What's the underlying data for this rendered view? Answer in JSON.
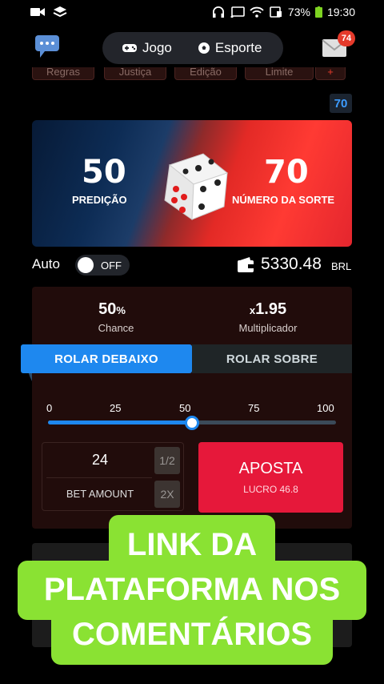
{
  "status_bar": {
    "battery": "73%",
    "time": "19:30"
  },
  "header": {
    "tabs": [
      {
        "label": "Jogo",
        "icon": "gamepad-icon"
      },
      {
        "label": "Esporte",
        "icon": "soccer-ball-icon"
      }
    ],
    "mail_badge": "74"
  },
  "top_tabs": [
    "Regras",
    "Justiça",
    "Edição",
    "Limite",
    "+"
  ],
  "last_result": "70",
  "hero": {
    "prediction_value": "50",
    "prediction_label": "PREDIÇÃO",
    "lucky_value": "70",
    "lucky_label": "NÚMERO DA SORTE"
  },
  "auto": {
    "label": "Auto",
    "state": "OFF"
  },
  "wallet": {
    "balance": "5330.48",
    "currency": "BRL"
  },
  "stats": {
    "chance_value": "50",
    "chance_unit": "%",
    "chance_label": "Chance",
    "multiplier_prefix": "x",
    "multiplier_value": "1.95",
    "multiplier_label": "Multiplicador"
  },
  "roll": {
    "under_label": "ROLAR DEBAIXO",
    "over_label": "ROLAR SOBRE",
    "active": "under"
  },
  "slider": {
    "ticks": [
      "0",
      "25",
      "50",
      "75",
      "100"
    ],
    "value": 50
  },
  "bet": {
    "amount": "24",
    "amount_label": "BET AMOUNT",
    "half_label": "1/2",
    "double_label": "2X",
    "button_label": "APOSTA",
    "profit_label": "LUCRO 46.8"
  },
  "promo": {
    "line1": "LINK DA",
    "line2": "PLATAFORMA NOS",
    "line3": "COMENTÁRIOS"
  },
  "colors": {
    "accent_blue": "#1e88ef",
    "bet_red": "#e6183a",
    "promo_green": "#8ae233"
  }
}
